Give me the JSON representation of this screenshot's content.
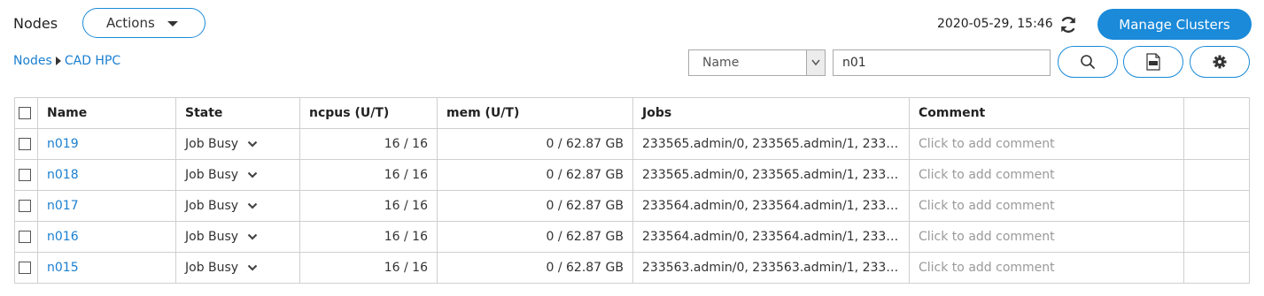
{
  "header": {
    "title": "Nodes",
    "actions_label": "Actions",
    "timestamp": "2020-05-29, 15:46",
    "manage_label": "Manage Clusters"
  },
  "breadcrumb": {
    "root": "Nodes",
    "current": "CAD HPC"
  },
  "filter": {
    "field": "Name",
    "value": "n01"
  },
  "table": {
    "columns": [
      "Name",
      "State",
      "ncpus (U/T)",
      "mem (U/T)",
      "Jobs",
      "Comment"
    ],
    "rows": [
      {
        "name": "n019",
        "state": "Job Busy",
        "ncpus": "16 / 16",
        "mem": "0 / 62.87 GB",
        "jobs": "233565.admin/0, 233565.admin/1, 2335...",
        "comment": "Click to add comment"
      },
      {
        "name": "n018",
        "state": "Job Busy",
        "ncpus": "16 / 16",
        "mem": "0 / 62.87 GB",
        "jobs": "233565.admin/0, 233565.admin/1, 2335...",
        "comment": "Click to add comment"
      },
      {
        "name": "n017",
        "state": "Job Busy",
        "ncpus": "16 / 16",
        "mem": "0 / 62.87 GB",
        "jobs": "233564.admin/0, 233564.admin/1, 2335...",
        "comment": "Click to add comment"
      },
      {
        "name": "n016",
        "state": "Job Busy",
        "ncpus": "16 / 16",
        "mem": "0 / 62.87 GB",
        "jobs": "233564.admin/0, 233564.admin/1, 2335...",
        "comment": "Click to add comment"
      },
      {
        "name": "n015",
        "state": "Job Busy",
        "ncpus": "16 / 16",
        "mem": "0 / 62.87 GB",
        "jobs": "233563.admin/0, 233563.admin/1, 2335...",
        "comment": "Click to add comment"
      }
    ]
  },
  "colors": {
    "accent": "#1a8ad9",
    "link": "#1a7fd0",
    "border": "#cfcfcf",
    "placeholder": "#9a9a9a"
  },
  "icons": [
    "refresh-icon",
    "dropdown-caret-icon",
    "search-icon",
    "csv-export-icon",
    "gear-icon",
    "chevron-down-icon"
  ]
}
